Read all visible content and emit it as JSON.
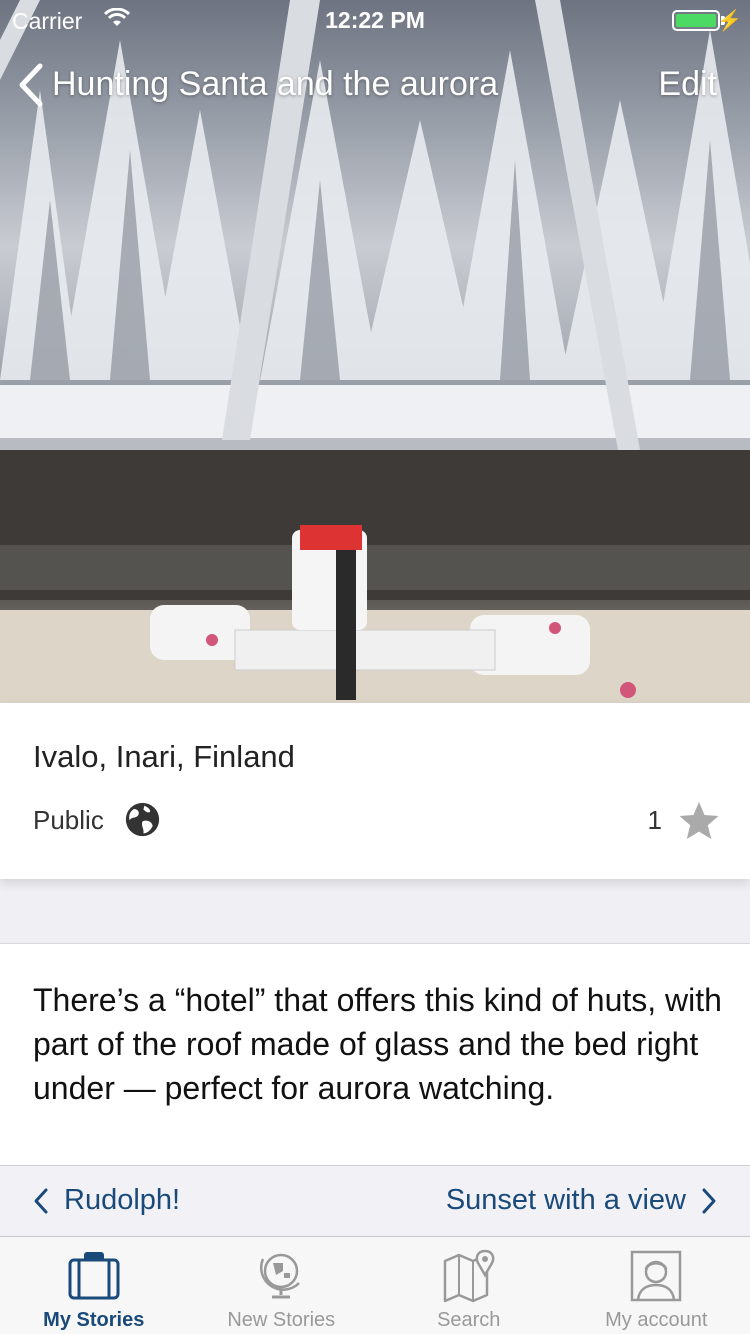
{
  "status_bar": {
    "carrier": "Carrier",
    "time": "12:22 PM"
  },
  "nav": {
    "title": "Hunting Santa and the aurora",
    "edit_label": "Edit"
  },
  "story": {
    "location": "Ivalo, Inari, Finland",
    "visibility": "Public",
    "star_count": "1",
    "description": "There’s a “hotel” that offers this kind of huts, with part of the roof made of glass and the bed right under — perfect for aurora watching."
  },
  "pager": {
    "prev_label": "Rudolph!",
    "next_label": "Sunset with a view"
  },
  "tabs": [
    {
      "label": "My Stories",
      "icon": "suitcase-icon",
      "active": true
    },
    {
      "label": "New Stories",
      "icon": "globe-map-icon",
      "active": false
    },
    {
      "label": "Search",
      "icon": "map-pin-icon",
      "active": false
    },
    {
      "label": "My account",
      "icon": "user-portrait-icon",
      "active": false
    }
  ],
  "colors": {
    "accent": "#1a4a7a",
    "battery": "#4cd964",
    "inactive_tab": "#999999"
  }
}
